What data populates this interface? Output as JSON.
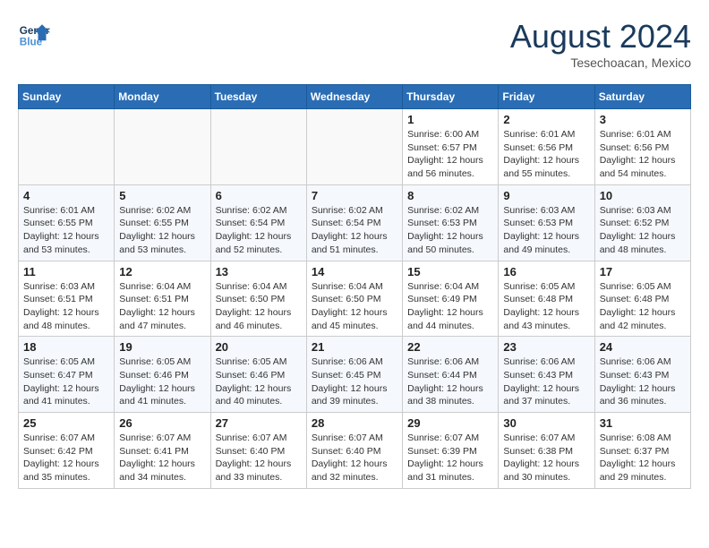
{
  "header": {
    "logo_line1": "General",
    "logo_line2": "Blue",
    "month_year": "August 2024",
    "location": "Tesechoacan, Mexico"
  },
  "days_of_week": [
    "Sunday",
    "Monday",
    "Tuesday",
    "Wednesday",
    "Thursday",
    "Friday",
    "Saturday"
  ],
  "weeks": [
    [
      {
        "day": "",
        "info": ""
      },
      {
        "day": "",
        "info": ""
      },
      {
        "day": "",
        "info": ""
      },
      {
        "day": "",
        "info": ""
      },
      {
        "day": "1",
        "info": "Sunrise: 6:00 AM\nSunset: 6:57 PM\nDaylight: 12 hours\nand 56 minutes."
      },
      {
        "day": "2",
        "info": "Sunrise: 6:01 AM\nSunset: 6:56 PM\nDaylight: 12 hours\nand 55 minutes."
      },
      {
        "day": "3",
        "info": "Sunrise: 6:01 AM\nSunset: 6:56 PM\nDaylight: 12 hours\nand 54 minutes."
      }
    ],
    [
      {
        "day": "4",
        "info": "Sunrise: 6:01 AM\nSunset: 6:55 PM\nDaylight: 12 hours\nand 53 minutes."
      },
      {
        "day": "5",
        "info": "Sunrise: 6:02 AM\nSunset: 6:55 PM\nDaylight: 12 hours\nand 53 minutes."
      },
      {
        "day": "6",
        "info": "Sunrise: 6:02 AM\nSunset: 6:54 PM\nDaylight: 12 hours\nand 52 minutes."
      },
      {
        "day": "7",
        "info": "Sunrise: 6:02 AM\nSunset: 6:54 PM\nDaylight: 12 hours\nand 51 minutes."
      },
      {
        "day": "8",
        "info": "Sunrise: 6:02 AM\nSunset: 6:53 PM\nDaylight: 12 hours\nand 50 minutes."
      },
      {
        "day": "9",
        "info": "Sunrise: 6:03 AM\nSunset: 6:53 PM\nDaylight: 12 hours\nand 49 minutes."
      },
      {
        "day": "10",
        "info": "Sunrise: 6:03 AM\nSunset: 6:52 PM\nDaylight: 12 hours\nand 48 minutes."
      }
    ],
    [
      {
        "day": "11",
        "info": "Sunrise: 6:03 AM\nSunset: 6:51 PM\nDaylight: 12 hours\nand 48 minutes."
      },
      {
        "day": "12",
        "info": "Sunrise: 6:04 AM\nSunset: 6:51 PM\nDaylight: 12 hours\nand 47 minutes."
      },
      {
        "day": "13",
        "info": "Sunrise: 6:04 AM\nSunset: 6:50 PM\nDaylight: 12 hours\nand 46 minutes."
      },
      {
        "day": "14",
        "info": "Sunrise: 6:04 AM\nSunset: 6:50 PM\nDaylight: 12 hours\nand 45 minutes."
      },
      {
        "day": "15",
        "info": "Sunrise: 6:04 AM\nSunset: 6:49 PM\nDaylight: 12 hours\nand 44 minutes."
      },
      {
        "day": "16",
        "info": "Sunrise: 6:05 AM\nSunset: 6:48 PM\nDaylight: 12 hours\nand 43 minutes."
      },
      {
        "day": "17",
        "info": "Sunrise: 6:05 AM\nSunset: 6:48 PM\nDaylight: 12 hours\nand 42 minutes."
      }
    ],
    [
      {
        "day": "18",
        "info": "Sunrise: 6:05 AM\nSunset: 6:47 PM\nDaylight: 12 hours\nand 41 minutes."
      },
      {
        "day": "19",
        "info": "Sunrise: 6:05 AM\nSunset: 6:46 PM\nDaylight: 12 hours\nand 41 minutes."
      },
      {
        "day": "20",
        "info": "Sunrise: 6:05 AM\nSunset: 6:46 PM\nDaylight: 12 hours\nand 40 minutes."
      },
      {
        "day": "21",
        "info": "Sunrise: 6:06 AM\nSunset: 6:45 PM\nDaylight: 12 hours\nand 39 minutes."
      },
      {
        "day": "22",
        "info": "Sunrise: 6:06 AM\nSunset: 6:44 PM\nDaylight: 12 hours\nand 38 minutes."
      },
      {
        "day": "23",
        "info": "Sunrise: 6:06 AM\nSunset: 6:43 PM\nDaylight: 12 hours\nand 37 minutes."
      },
      {
        "day": "24",
        "info": "Sunrise: 6:06 AM\nSunset: 6:43 PM\nDaylight: 12 hours\nand 36 minutes."
      }
    ],
    [
      {
        "day": "25",
        "info": "Sunrise: 6:07 AM\nSunset: 6:42 PM\nDaylight: 12 hours\nand 35 minutes."
      },
      {
        "day": "26",
        "info": "Sunrise: 6:07 AM\nSunset: 6:41 PM\nDaylight: 12 hours\nand 34 minutes."
      },
      {
        "day": "27",
        "info": "Sunrise: 6:07 AM\nSunset: 6:40 PM\nDaylight: 12 hours\nand 33 minutes."
      },
      {
        "day": "28",
        "info": "Sunrise: 6:07 AM\nSunset: 6:40 PM\nDaylight: 12 hours\nand 32 minutes."
      },
      {
        "day": "29",
        "info": "Sunrise: 6:07 AM\nSunset: 6:39 PM\nDaylight: 12 hours\nand 31 minutes."
      },
      {
        "day": "30",
        "info": "Sunrise: 6:07 AM\nSunset: 6:38 PM\nDaylight: 12 hours\nand 30 minutes."
      },
      {
        "day": "31",
        "info": "Sunrise: 6:08 AM\nSunset: 6:37 PM\nDaylight: 12 hours\nand 29 minutes."
      }
    ]
  ]
}
